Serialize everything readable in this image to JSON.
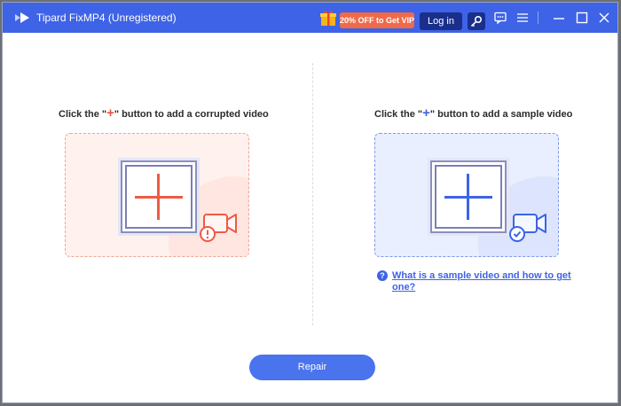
{
  "window": {
    "title": "Tipard FixMP4 (Unregistered)",
    "promo_label": "20% OFF to Get VIP",
    "login_label": "Log in",
    "icons": [
      "app-logo-icon",
      "gift-icon",
      "key-icon",
      "chat-icon",
      "menu-icon",
      "minimize-icon",
      "maximize-icon",
      "close-icon"
    ]
  },
  "corrupted": {
    "instruction_prefix": "Click the \"",
    "instruction_plus": "+",
    "instruction_suffix": "\" button to add a corrupted video",
    "accent": "#ef5a44"
  },
  "sample": {
    "instruction_prefix": "Click the \"",
    "instruction_plus": "+",
    "instruction_suffix": "\" button to add a sample video",
    "accent": "#3e63e6",
    "help_link": "What is a sample video and how to get one?"
  },
  "actions": {
    "repair_label": "Repair"
  },
  "colors": {
    "titlebar": "#3e63e6",
    "promo": "#f06a4a",
    "login": "#1a2f8c",
    "repair": "#4a73ee"
  }
}
